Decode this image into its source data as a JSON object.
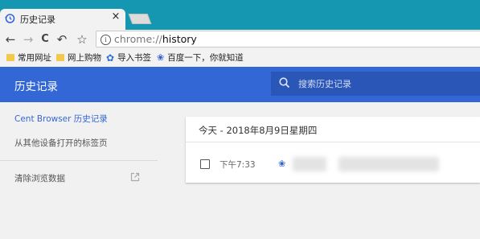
{
  "window": {
    "tab_title": "历史记录",
    "tab_close": "×"
  },
  "toolbar": {
    "back_icon": "←",
    "forward_icon": "→",
    "reload_icon": "C",
    "undo_icon": "↶",
    "bookmark_star": "☆",
    "info_icon": "i",
    "url_scheme": "chrome://",
    "url_host": "history"
  },
  "bookmarks": [
    {
      "label": "常用网址",
      "icon": "folder-icon"
    },
    {
      "label": "网上购物",
      "icon": "folder-icon"
    },
    {
      "label": "导入书签",
      "icon": "gear-icon"
    },
    {
      "label": "百度一下，你就知道",
      "icon": "baidu-paw-icon"
    }
  ],
  "app": {
    "title": "历史记录",
    "search_placeholder": "搜索历史记录"
  },
  "sidebar": {
    "active_item": "Cent Browser 历史记录",
    "other_devices": "从其他设备打开的标签页",
    "clear_data": "清除浏览数据"
  },
  "history": {
    "date_header": "今天 - 2018年8月9日星期四",
    "entries": [
      {
        "time": "下午7:33",
        "favicon": "baidu-paw-icon"
      }
    ]
  },
  "colors": {
    "titlebar": "#1597b1",
    "appbar": "#3367d6",
    "accent": "#3367d6"
  }
}
